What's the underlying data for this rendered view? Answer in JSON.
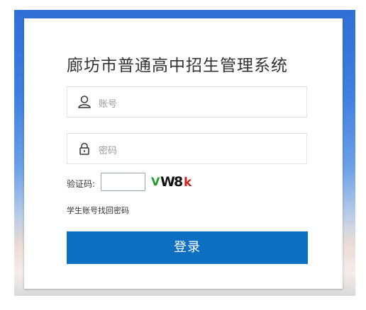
{
  "login": {
    "title": "廊坊市普通高中招生管理系统",
    "username_placeholder": "账号",
    "password_placeholder": "密码",
    "captcha_label": "验证码:",
    "captcha_value": "",
    "captcha_chars": [
      "V",
      "W8",
      "k"
    ],
    "captcha_colors": [
      "#1f9c2e",
      "#111111",
      "#d52020"
    ],
    "recover_link": "学生账号找回密码",
    "submit_label": "登录"
  },
  "theme": {
    "accent": "#0c6fc2",
    "backdrop_top": "#2f6fd6"
  },
  "icons": {
    "username": "user-icon",
    "password": "lock-icon"
  }
}
